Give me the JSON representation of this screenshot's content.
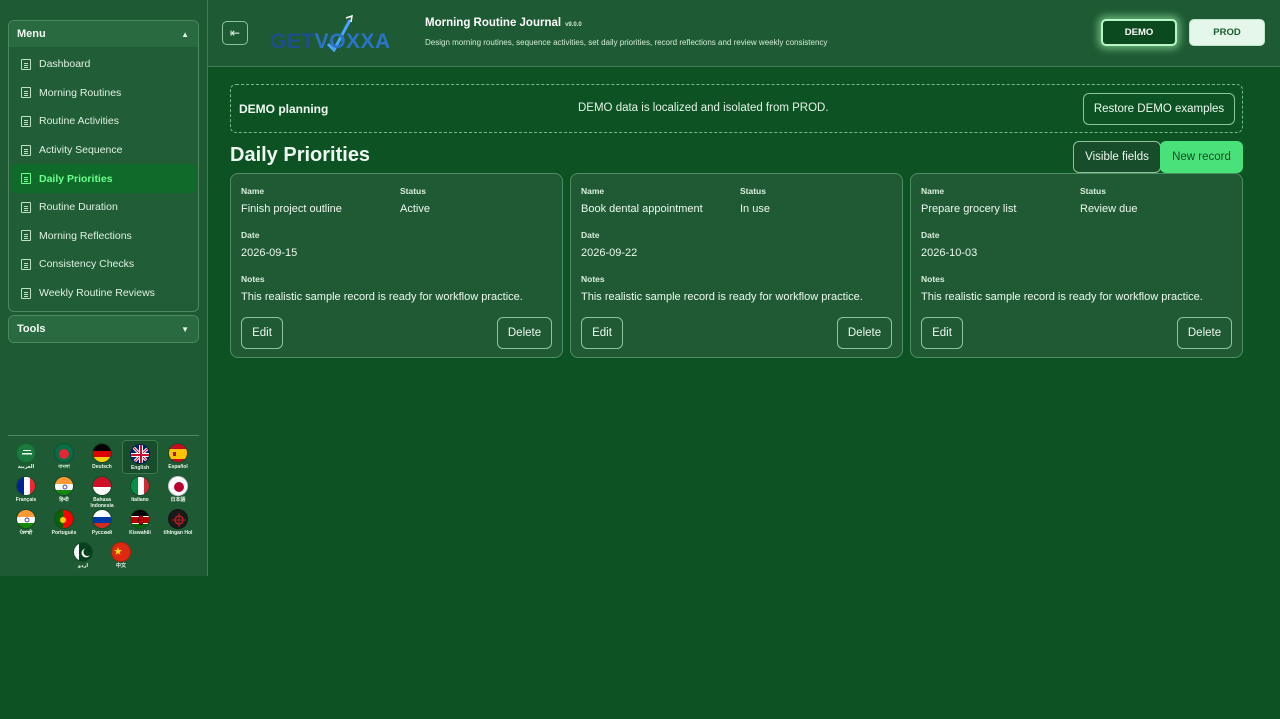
{
  "sidebar": {
    "menu_title": "Menu",
    "tools_title": "Tools",
    "items": [
      {
        "label": "Dashboard"
      },
      {
        "label": "Morning Routines"
      },
      {
        "label": "Routine Activities"
      },
      {
        "label": "Activity Sequence"
      },
      {
        "label": "Daily Priorities",
        "active": true
      },
      {
        "label": "Routine Duration"
      },
      {
        "label": "Morning Reflections"
      },
      {
        "label": "Consistency Checks"
      },
      {
        "label": "Weekly Routine Reviews"
      }
    ],
    "languages": [
      {
        "label": "العربية",
        "flag": "saudi-arabia-flag-icon"
      },
      {
        "label": "বাংলা",
        "flag": "bangladesh-flag-icon"
      },
      {
        "label": "Deutsch",
        "flag": "germany-flag-icon"
      },
      {
        "label": "English",
        "flag": "uk-flag-icon",
        "selected": true
      },
      {
        "label": "Español",
        "flag": "spain-flag-icon"
      },
      {
        "label": "Français",
        "flag": "france-flag-icon"
      },
      {
        "label": "हिन्दी",
        "flag": "india-flag-icon"
      },
      {
        "label": "Bahasa Indonesia",
        "flag": "indonesia-flag-icon"
      },
      {
        "label": "Italiano",
        "flag": "italy-flag-icon"
      },
      {
        "label": "日本語",
        "flag": "japan-flag-icon"
      },
      {
        "label": "ਪੰਜਾਬੀ",
        "flag": "india-flag-icon"
      },
      {
        "label": "Português",
        "flag": "portugal-flag-icon"
      },
      {
        "label": "Русский",
        "flag": "russia-flag-icon"
      },
      {
        "label": "Kiswahili",
        "flag": "kenya-flag-icon"
      },
      {
        "label": "tlhIngan Hol",
        "flag": "klingon-flag-icon"
      },
      {
        "label": "اردو",
        "flag": "pakistan-flag-icon"
      },
      {
        "label": "中文",
        "flag": "china-flag-icon"
      }
    ]
  },
  "header": {
    "logo_text_1": "GET",
    "logo_text_2": "V",
    "logo_text_3": "OXXA",
    "title": "Morning Routine Journal",
    "version": "v9.0.0",
    "subtitle": "Design morning routines, sequence activities, set daily priorities, record reflections and review weekly consistency",
    "demo_label": "DEMO",
    "prod_label": "PROD"
  },
  "banner": {
    "title": "DEMO planning",
    "message": "DEMO data is localized and isolated from PROD.",
    "restore_label": "Restore DEMO examples"
  },
  "main": {
    "page_title": "Daily Priorities",
    "visible_fields_label": "Visible fields",
    "new_record_label": "New record",
    "labels": {
      "name": "Name",
      "status": "Status",
      "date": "Date",
      "notes": "Notes",
      "edit": "Edit",
      "delete": "Delete"
    },
    "records": [
      {
        "name": "Finish project outline",
        "status": "Active",
        "date": "2026-09-15",
        "notes": "This realistic sample record is ready for workflow practice."
      },
      {
        "name": "Book dental appointment",
        "status": "In use",
        "date": "2026-09-22",
        "notes": "This realistic sample record is ready for workflow practice."
      },
      {
        "name": "Prepare grocery list",
        "status": "Review due",
        "date": "2026-10-03",
        "notes": "This realistic sample record is ready for workflow practice."
      }
    ]
  },
  "colors": {
    "background": "#0d5223",
    "panel": "#1e5a33",
    "accent": "#49e27a",
    "active_text": "#6bff8e"
  }
}
